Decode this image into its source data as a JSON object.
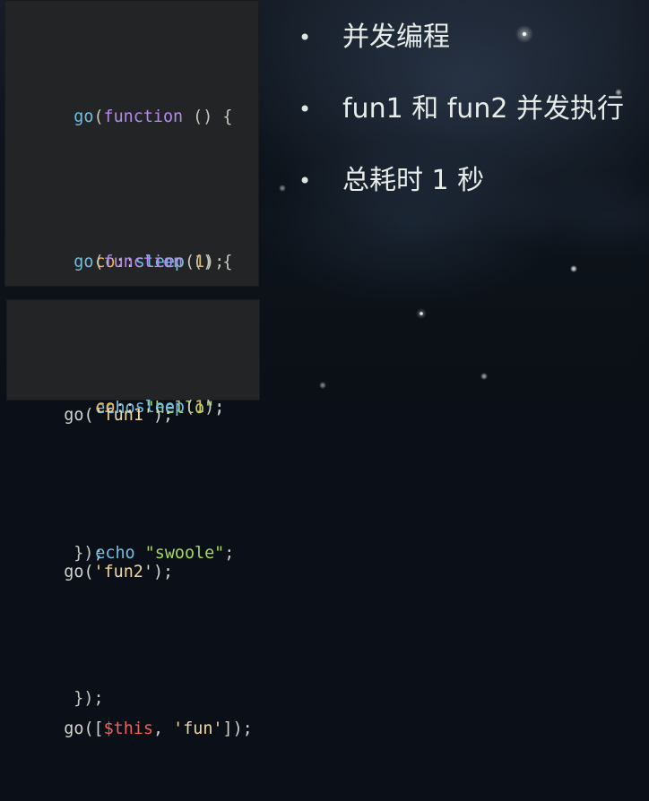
{
  "code_panel_top": {
    "block_1": {
      "line_1": {
        "part_1": "go",
        "part_2": "(",
        "part_3": "function",
        "part_4": " () {"
      },
      "line_2": {
        "part_1": "co",
        "part_2": "::",
        "part_3": "sleep",
        "part_4": "(",
        "part_5": "1",
        "part_6": ");"
      },
      "line_3": {
        "part_1": "echo",
        "part_2": " ",
        "part_3": "\"hello\"",
        "part_4": ";"
      },
      "line_4": {
        "part_1": "});"
      }
    },
    "block_2": {
      "line_1": {
        "part_1": "go",
        "part_2": "(",
        "part_3": "function",
        "part_4": " () {"
      },
      "line_2": {
        "part_1": "co",
        "part_2": "::",
        "part_3": "sleep",
        "part_4": "(",
        "part_5": "1",
        "part_6": ");"
      },
      "line_3": {
        "part_1": "echo",
        "part_2": " ",
        "part_3": "\"swoole\"",
        "part_4": ";"
      },
      "line_4": {
        "part_1": "});"
      }
    }
  },
  "code_panel_bottom": {
    "line_1": {
      "part_1": "go(",
      "part_2": "'fun1'",
      "part_3": ");"
    },
    "line_2": {
      "part_1": "go(",
      "part_2": "'fun2'",
      "part_3": ");"
    },
    "line_3": {
      "part_1": "go([",
      "part_2": "$this",
      "part_3": ", ",
      "part_4": "'fun'",
      "part_5": "]);"
    }
  },
  "slide_content": {
    "bullets": [
      {
        "marker": "•",
        "text": "并发编程"
      },
      {
        "marker": "•",
        "text": "fun1 和 fun2 并发执行"
      },
      {
        "marker": "•",
        "text": "总耗时 1 秒"
      }
    ]
  },
  "colors": {
    "panel_background": "#232426",
    "function_blue": "#74bde0",
    "keyword_purple": "#b38be9",
    "object_orange": "#f0b64e",
    "string_green": "#a7d65b",
    "variable_red": "#ef625a",
    "slide_text": "#e7ece8"
  }
}
